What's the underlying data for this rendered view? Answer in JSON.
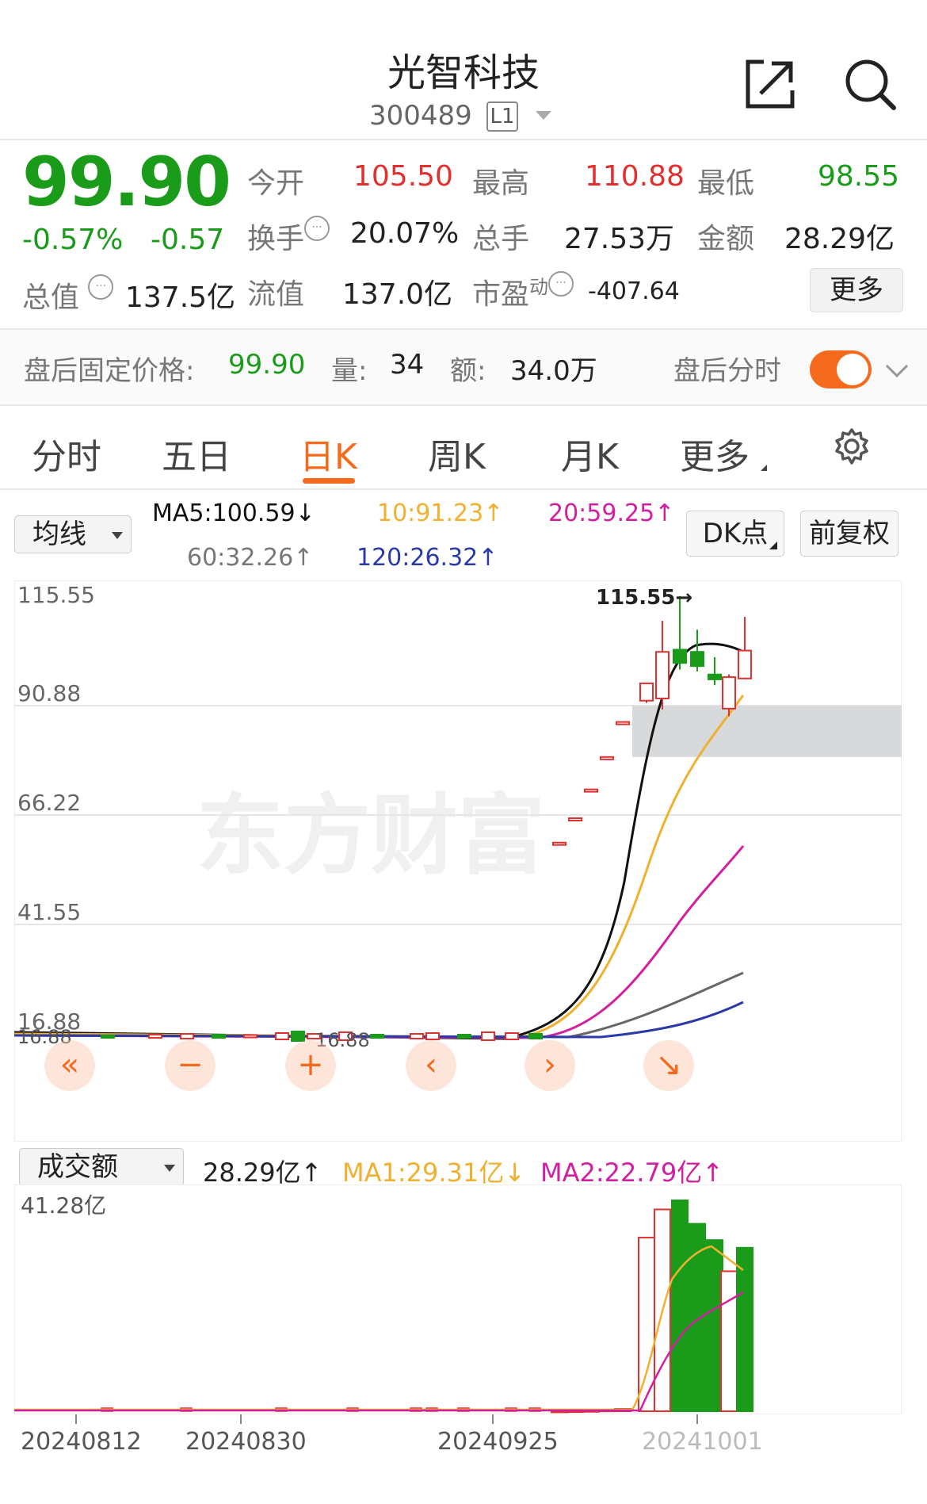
{
  "header": {
    "title": "光智科技",
    "code": "300489",
    "level": "L1"
  },
  "quote": {
    "price": "99.90",
    "change_pct": "-0.57%",
    "change": "-0.57",
    "open_label": "今开",
    "open": "105.50",
    "high_label": "最高",
    "high": "110.88",
    "low_label": "最低",
    "low": "98.55",
    "turnover_label": "换手",
    "turnover": "20.07%",
    "volume_label": "总手",
    "volume": "27.53万",
    "amount_label": "金额",
    "amount": "28.29亿",
    "mktcap_label": "总值",
    "mktcap": "137.5亿",
    "float_label": "流值",
    "float_cap": "137.0亿",
    "pe_label": "市盈",
    "pe_sup": "动",
    "pe": "-407.64",
    "more_label": "更多"
  },
  "afterhours": {
    "label": "盘后固定价格:",
    "price": "99.90",
    "vol_label": "量:",
    "vol": "34",
    "amt_label": "额:",
    "amt": "34.0万",
    "toggle_label": "盘后分时"
  },
  "tabs": [
    "分时",
    "五日",
    "日K",
    "周K",
    "月K",
    "更多"
  ],
  "active_tab": "日K",
  "indicator": {
    "select": "均线",
    "ma5": "MA5:100.59↓",
    "ma10": "10:91.23↑",
    "ma20": "20:59.25↑",
    "ma60": "60:32.26↑",
    "ma120": "120:26.32↑",
    "dk_label": "DK点",
    "fq_label": "前复权"
  },
  "colors": {
    "up": "#e03030",
    "down": "#1a9c1a",
    "accent": "#f56a1d",
    "ma5": "#111111",
    "ma10": "#f0b030",
    "ma20": "#d020a0",
    "ma60": "#666666",
    "ma120": "#2a3aa8"
  },
  "chart_controls": [
    "«",
    "−",
    "+",
    "‹",
    "›",
    "↘"
  ],
  "volume_panel": {
    "select": "成交额",
    "value": "28.29亿↑",
    "ma1": "MA1:29.31亿↓",
    "ma2": "MA2:22.79亿↑",
    "max_label": "41.28亿"
  },
  "watermark": "东方财富",
  "chart_data": [
    {
      "type": "candlestick",
      "y_ticks": [
        "115.55",
        "90.88",
        "66.22",
        "41.55",
        "16.88"
      ],
      "ylim": [
        16.88,
        115.55
      ],
      "max_annotation": "115.55→",
      "min_annotation": "16.88",
      "candles": [
        {
          "open": 60.0,
          "close": 60.0,
          "high": 60.0,
          "low": 60.0
        },
        {
          "open": 65.5,
          "close": 65.5,
          "high": 65.5,
          "low": 65.5
        },
        {
          "open": 72.0,
          "close": 72.0,
          "high": 72.0,
          "low": 72.0
        },
        {
          "open": 79.3,
          "close": 79.3,
          "high": 79.3,
          "low": 79.3
        },
        {
          "open": 87.2,
          "close": 87.2,
          "high": 87.2,
          "low": 87.2
        },
        {
          "open": 92.0,
          "close": 95.9,
          "high": 95.9,
          "low": 91.5
        },
        {
          "open": 92.5,
          "close": 103.0,
          "high": 110.0,
          "low": 90.0
        },
        {
          "open": 103.5,
          "close": 100.5,
          "high": 115.55,
          "low": 99.0
        },
        {
          "open": 103.0,
          "close": 99.8,
          "high": 108.0,
          "low": 98.6
        },
        {
          "open": 97.9,
          "close": 96.8,
          "high": 101.8,
          "low": 95.5
        },
        {
          "open": 90.2,
          "close": 97.3,
          "high": 97.9,
          "low": 88.5
        },
        {
          "open": 97.0,
          "close": 103.3,
          "high": 110.88,
          "low": 98.55
        }
      ],
      "gap_band": [
        79.3,
        90.88
      ],
      "x_ticks": [
        "20240812",
        "20240830",
        "20240925",
        "20241001"
      ]
    },
    {
      "type": "bar",
      "title": "成交额",
      "series": [
        {
          "name": "成交额",
          "values": [
            0.1,
            0.15,
            0.2,
            0.3,
            0.45,
            34.0,
            39.5,
            41.28,
            36.7,
            33.5,
            27.4,
            32.0
          ]
        }
      ],
      "bar_colors": [
        "up",
        "up",
        "up",
        "up",
        "up",
        "up",
        "up",
        "down",
        "down",
        "down",
        "up",
        "down"
      ],
      "ylim": [
        0,
        41.28
      ]
    }
  ]
}
